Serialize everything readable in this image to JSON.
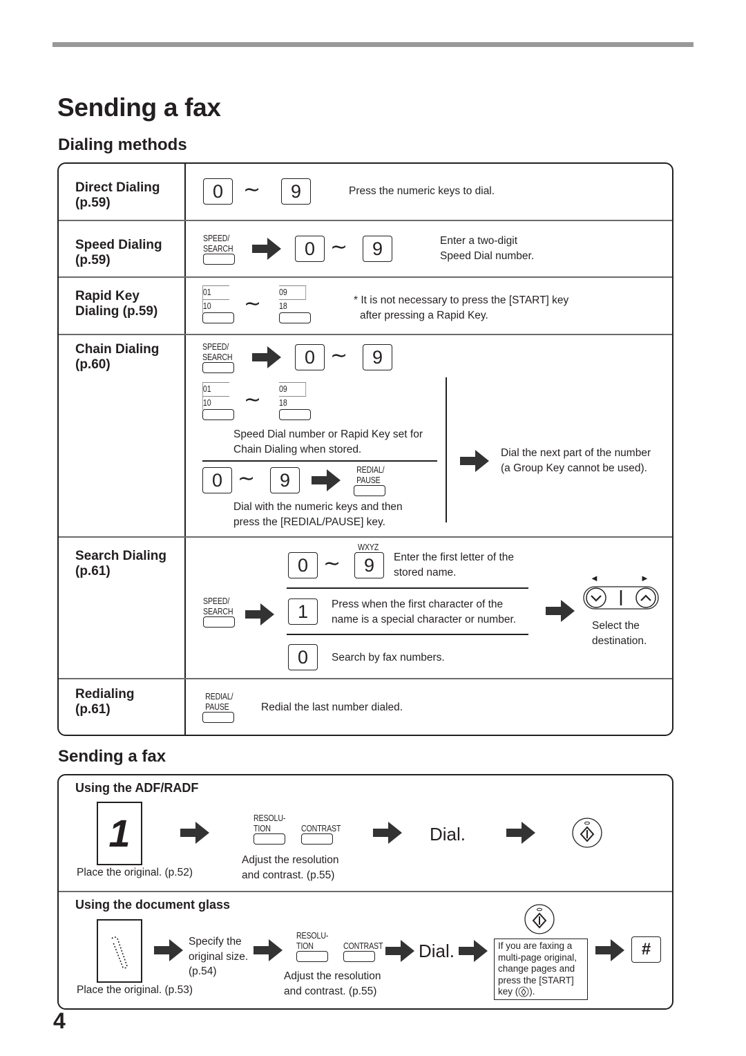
{
  "page": {
    "title": "Sending a fax",
    "page_number": "4"
  },
  "dialing_methods": {
    "heading": "Dialing methods",
    "rows": [
      {
        "label": "Direct Dialing",
        "page_ref": "(p.59)",
        "description": "Press the numeric keys to dial."
      },
      {
        "label": "Speed Dialing",
        "page_ref": "(p.59)",
        "description_line1": "Enter a two-digit",
        "description_line2": "Speed Dial number."
      },
      {
        "label_line1": "Rapid Key",
        "label_line2": "Dialing (p.59)",
        "note_line1": "* It is not necessary to press the [START] key",
        "note_line2": "after pressing a Rapid Key."
      },
      {
        "label": "Chain Dialing",
        "page_ref": "(p.60)",
        "option1_line1": "Speed Dial number or Rapid Key set for",
        "option1_line2": "Chain Dialing when stored.",
        "option2_line1": "Dial with the numeric keys and then",
        "option2_line2": "press the [REDIAL/PAUSE] key.",
        "next_line1": "Dial the next part of the number",
        "next_line2": "(a Group Key cannot be used)."
      },
      {
        "label": "Search Dialing",
        "page_ref": "(p.61)",
        "key_letters": "WXYZ",
        "option1_line1": "Enter the first letter of the",
        "option1_line2": "stored name.",
        "option2_line1": "Press when the first character of the",
        "option2_line2": "name is a special character or number.",
        "option3": "Search by fax numbers.",
        "select_line1": "Select the",
        "select_line2": "destination."
      },
      {
        "label": "Redialing",
        "page_ref": "(p.61)",
        "description": "Redial the last number dialed."
      }
    ]
  },
  "keys": {
    "zero": "0",
    "nine": "9",
    "one": "1",
    "hash": "#",
    "tilde": "∼",
    "speed_search_line1": "SPEED/",
    "speed_search_line2": "SEARCH",
    "redial_pause_line1": "REDIAL/",
    "redial_pause_line2": "PAUSE",
    "resolution_line1": "RESOLU-",
    "resolution_line2": "TION",
    "contrast": "CONTRAST",
    "rapid_01": "01",
    "rapid_10": "10",
    "rapid_09": "09",
    "rapid_18": "18",
    "left_arrow": "◄",
    "right_arrow": "►"
  },
  "sending": {
    "heading": "Sending a fax",
    "adf": {
      "title": "Using the ADF/RADF",
      "doc_glyph": "1",
      "place_original": "Place the original. (p.52)",
      "adjust_line1": "Adjust the resolution",
      "adjust_line2": "and contrast. (p.55)",
      "dial": "Dial."
    },
    "glass": {
      "title": "Using the document glass",
      "place_original": "Place the original. (p.53)",
      "specify_line1": "Specify the",
      "specify_line2": "original size.",
      "specify_line3": "(p.54)",
      "adjust_line1": "Adjust the resolution",
      "adjust_line2": "and contrast. (p.55)",
      "dial": "Dial.",
      "note_line1": "If you are faxing a",
      "note_line2": "multi-page original,",
      "note_line3": "change pages and",
      "note_line4": "press the [START]",
      "note_line5_prefix": "key (",
      "note_line5_suffix": ")."
    }
  }
}
